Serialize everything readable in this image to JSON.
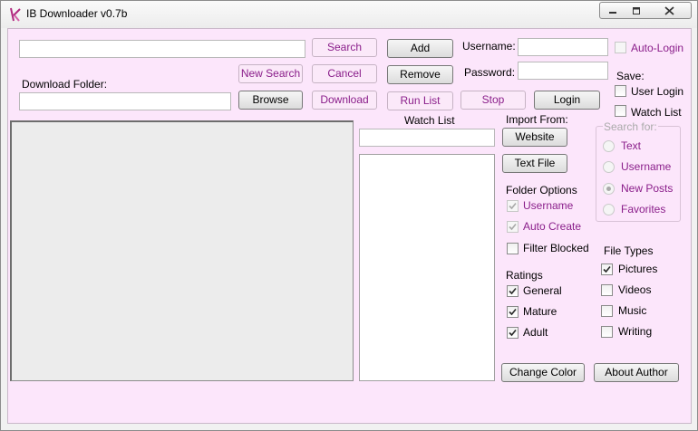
{
  "window": {
    "title": "IB Downloader v0.7b"
  },
  "search": {
    "value": "",
    "button": "Search",
    "new_search": "New Search",
    "cancel": "Cancel"
  },
  "download": {
    "folder_label": "Download Folder:",
    "folder_value": "",
    "browse": "Browse",
    "download": "Download"
  },
  "actions": {
    "add": "Add",
    "remove": "Remove",
    "run_list": "Run List",
    "stop": "Stop",
    "login": "Login"
  },
  "login": {
    "username_label": "Username:",
    "password_label": "Password:",
    "username_value": "",
    "password_value": "",
    "auto_login": "Auto-Login"
  },
  "save": {
    "label": "Save:",
    "user_login": "User Login",
    "watch_list": "Watch List"
  },
  "watch_list": {
    "label": "Watch List",
    "input_value": ""
  },
  "import_from": {
    "label": "Import From:",
    "website": "Website",
    "text_file": "Text File"
  },
  "search_for": {
    "label": "Search for:",
    "options": [
      "Text",
      "Username",
      "New Posts",
      "Favorites"
    ],
    "selected": "New Posts"
  },
  "folder_options": {
    "label": "Folder Options",
    "username": "Username",
    "auto_create": "Auto Create",
    "filter_blocked": "Filter Blocked"
  },
  "ratings": {
    "label": "Ratings",
    "general": "General",
    "mature": "Mature",
    "adult": "Adult"
  },
  "file_types": {
    "label": "File Types",
    "pictures": "Pictures",
    "videos": "Videos",
    "music": "Music",
    "writing": "Writing"
  },
  "bottom": {
    "change_color": "Change Color",
    "about_author": "About Author"
  },
  "colors": {
    "client_bg": "#fce6fb",
    "accent_text": "#8a1e8a"
  },
  "checks": {
    "auto_login": false,
    "save_user_login": false,
    "save_watch_list": false,
    "folder_username": true,
    "folder_auto_create": true,
    "filter_blocked": false,
    "general": true,
    "mature": true,
    "adult": true,
    "pictures": true,
    "videos": false,
    "music": false,
    "writing": false
  }
}
